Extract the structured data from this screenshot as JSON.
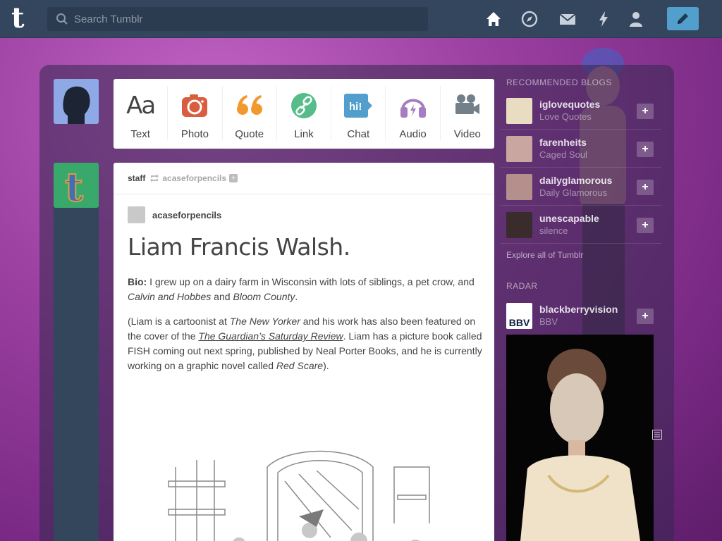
{
  "topbar": {
    "logo": "t",
    "search_placeholder": "Search Tumblr",
    "nav": [
      "home-icon",
      "explore-compass-icon",
      "inbox-mail-icon",
      "activity-bolt-icon",
      "account-person-icon"
    ],
    "compose_icon": "pencil-icon",
    "compose_color": "#529ecc"
  },
  "post_types": [
    {
      "label": "Text",
      "glyph": "Aa",
      "color": "#444444"
    },
    {
      "label": "Photo",
      "color": "#d95e40"
    },
    {
      "label": "Quote",
      "glyph": "“",
      "color": "#f2992e"
    },
    {
      "label": "Link",
      "color": "#56bc8a"
    },
    {
      "label": "Chat",
      "glyph": "hi!",
      "color": "#529ecc"
    },
    {
      "label": "Audio",
      "color": "#a77dc2"
    },
    {
      "label": "Video",
      "color": "#748089"
    }
  ],
  "post": {
    "author": "staff",
    "reblogged_from": "acaseforpencils",
    "blog_name": "acaseforpencils",
    "title": "Liam Francis Walsh.",
    "bio_label": "Bio:",
    "bio_text_1": " I grew up on a dairy farm in Wisconsin with lots of siblings, a pet crow, and ",
    "bio_work_1": "Calvin and Hobbes",
    "bio_text_2": " and ",
    "bio_work_2": "Bloom County",
    "bio_text_3": ".",
    "p2_a": "(Liam is a cartoonist at ",
    "p2_nyer": "The New Yorker",
    "p2_b": " and his work has also been featured on the cover of the ",
    "p2_guardian": "The Guardian’s Saturday Review",
    "p2_c": ". Liam has a picture book called FISH coming out next spring, published by Neal Porter Books, and he is currently working on a graphic novel called ",
    "p2_redscare": "Red Scare",
    "p2_d": ")."
  },
  "sidebar": {
    "recommended_heading": "RECOMMENDED BLOGS",
    "recommended": [
      {
        "name": "iglovequotes",
        "title": "Love Quotes",
        "follow": "+"
      },
      {
        "name": "farenheits",
        "title": "Caged Soul",
        "follow": "+"
      },
      {
        "name": "dailyglamorous",
        "title": "Daily Glamorous",
        "follow": "+"
      },
      {
        "name": "unescapable",
        "title": "silence",
        "follow": "+"
      }
    ],
    "explore_link": "Explore all of Tumblr",
    "radar_heading": "RADAR",
    "radar": {
      "name": "blackberryvision",
      "title": "BBV",
      "avatar_text": "BBV",
      "follow": "+"
    }
  }
}
